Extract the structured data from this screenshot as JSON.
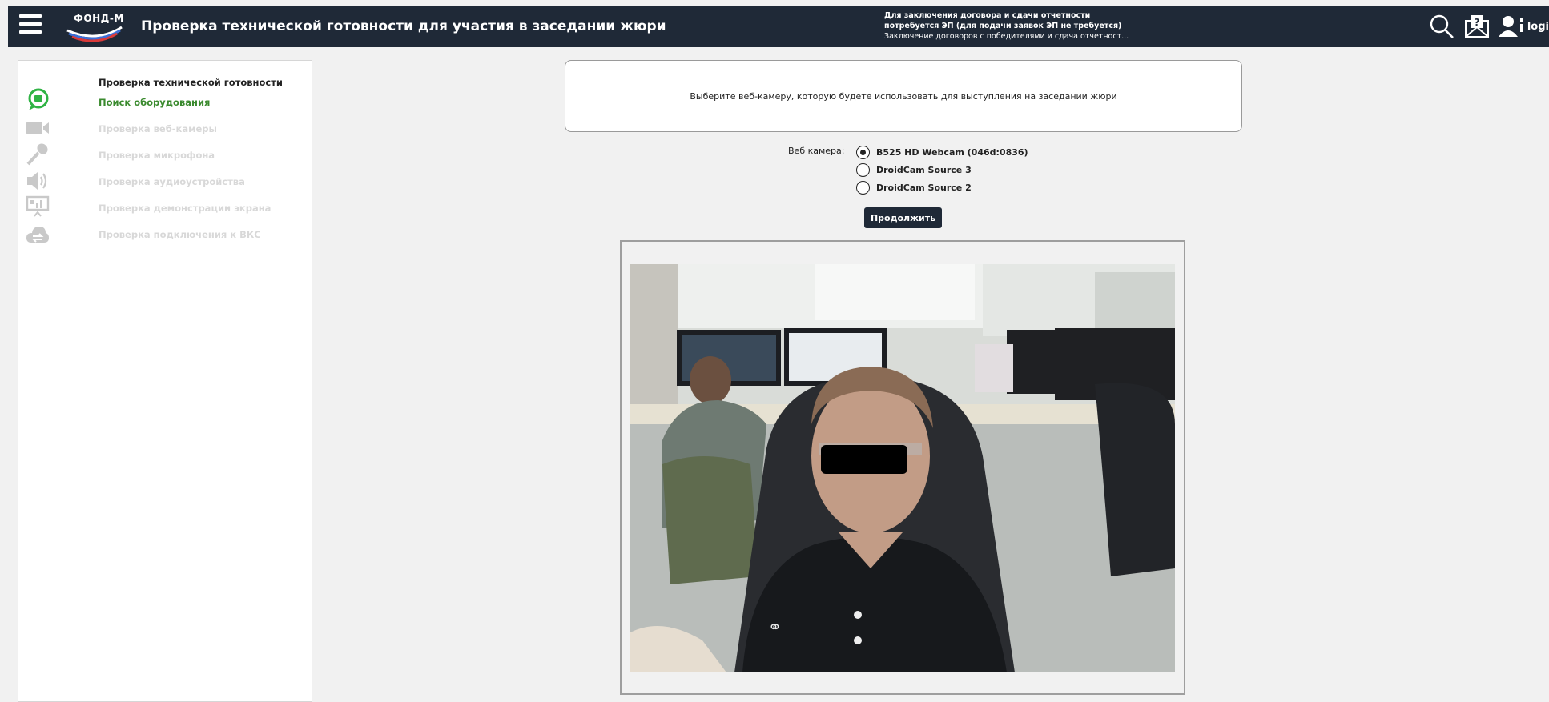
{
  "header": {
    "logo_text": "ФОНД-М",
    "title": "Проверка технической готовности для участия в заседании жюри",
    "notice_line1": "Для заключения договора и сдачи отчетности",
    "notice_line2": "потребуется ЭП (для подачи заявок ЭП не требуется)",
    "notice_line3": "Заключение договоров с победителями и сдача отчетност...",
    "login_label": "logi",
    "icons": [
      "menu-icon",
      "search-icon",
      "help-mail-icon",
      "user-icon"
    ]
  },
  "sidebar": {
    "title": "Проверка технической готовности",
    "items": [
      {
        "label": "Поиск оборудования",
        "icon": "chat-bubble-icon",
        "active": true
      },
      {
        "label": "Проверка веб-камеры",
        "icon": "video-camera-icon",
        "active": false
      },
      {
        "label": "Проверка микрофона",
        "icon": "microphone-icon",
        "active": false
      },
      {
        "label": "Проверка аудиоустройства",
        "icon": "speaker-icon",
        "active": false
      },
      {
        "label": "Проверка демонстрации экрана",
        "icon": "screen-share-icon",
        "active": false
      },
      {
        "label": "Проверка подключения к ВКС",
        "icon": "cloud-sync-icon",
        "active": false
      }
    ]
  },
  "main": {
    "instruction": "Выберите веб-камеру, которую будете использовать для выступления на заседании жюри",
    "camera_label": "Веб камера:",
    "cameras": [
      {
        "label": "B525 HD Webcam (046d:0836)",
        "selected": true
      },
      {
        "label": "DroidCam Source 3",
        "selected": false
      },
      {
        "label": "DroidCam Source 2",
        "selected": false
      }
    ],
    "continue_label": "Продолжить"
  },
  "colors": {
    "header_bg": "#1f2937",
    "active_green": "#3a8a2e",
    "icon_green": "#2fb344",
    "page_bg": "#f1f1f1"
  }
}
